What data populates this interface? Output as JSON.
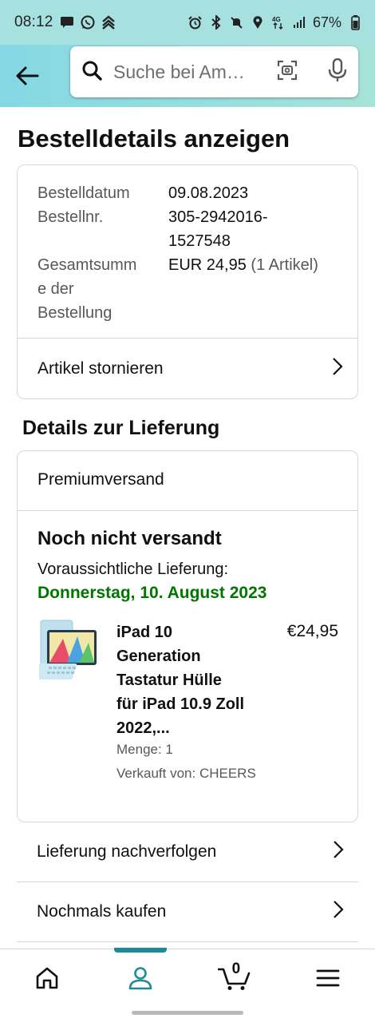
{
  "status_bar": {
    "time": "08:12",
    "battery": "67%",
    "left_icons": [
      "message-icon",
      "whatsapp-icon",
      "app-icon"
    ],
    "right_icons": [
      "alarm-icon",
      "bluetooth-icon",
      "mute-icon",
      "location-icon",
      "4g-icon",
      "signal-icon",
      "battery-icon"
    ]
  },
  "header": {
    "search_placeholder": "Suche bei Am…"
  },
  "page": {
    "title": "Bestelldetails anzeigen"
  },
  "order": {
    "date_label": "Bestelldatum",
    "date_value": "09.08.2023",
    "number_label": "Bestellnr.",
    "number_value_line1": "305-2942016-",
    "number_value_line2": "1527548",
    "total_label_line1": "Gesamtsumm",
    "total_label_line2": "e der",
    "total_label_line3": "Bestellung",
    "total_value": "EUR 24,95",
    "total_items": "(1 Artikel)",
    "cancel_label": "Artikel stornieren"
  },
  "delivery": {
    "section_title": "Details zur Lieferung",
    "shipping_method": "Premiumversand",
    "status": "Noch nicht versandt",
    "expected_label": "Voraussichtliche Lieferung:",
    "expected_date": "Donnerstag, 10. August 2023",
    "product": {
      "title_line1": "iPad 10",
      "title_line2": "Generation",
      "title_line3": "Tastatur Hülle",
      "title_line4": "für iPad 10.9 Zoll",
      "title_line5": "2022,...",
      "price": "€24,95",
      "quantity": "Menge: 1",
      "seller": "Verkauft von: CHEERS"
    }
  },
  "actions": {
    "track": "Lieferung nachverfolgen",
    "rebuy": "Nochmals kaufen"
  },
  "bottom_nav": {
    "cart_count": "0",
    "active": "account",
    "accent_color": "#1d8c99"
  },
  "colors": {
    "delivery_green": "#007600",
    "header_teal": "#a6e1e0"
  }
}
